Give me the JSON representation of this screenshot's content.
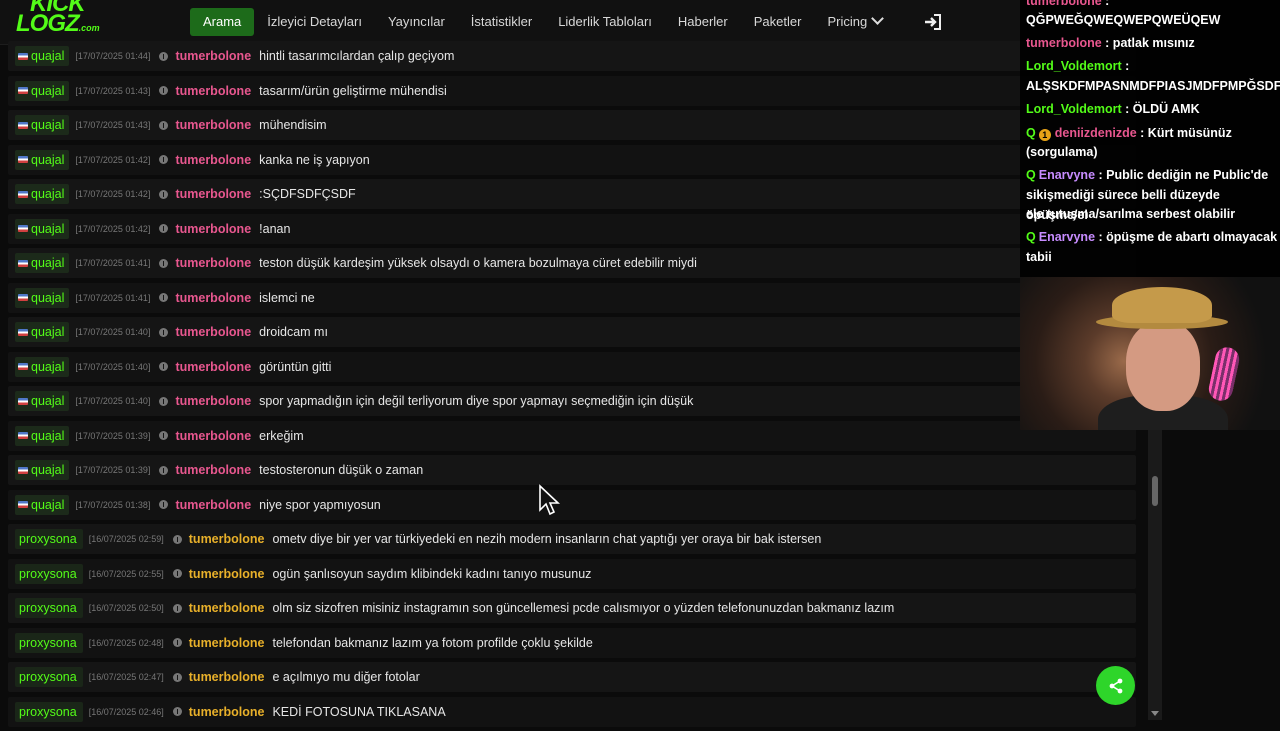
{
  "nav": {
    "logo_top": "KICK",
    "logo_bottom": "LOGZ",
    "logo_suffix": ".com",
    "items": [
      {
        "label": "Arama",
        "active": true
      },
      {
        "label": "İzleyici Detayları"
      },
      {
        "label": "Yayıncılar"
      },
      {
        "label": "İstatistikler"
      },
      {
        "label": "Liderlik Tabloları"
      },
      {
        "label": "Haberler"
      },
      {
        "label": "Paketler"
      },
      {
        "label": "Pricing"
      }
    ]
  },
  "messages": [
    {
      "channel": "quajal",
      "timestamp": "[17/07/2025 01:44]",
      "user": "tumerbolone",
      "text": "hintli tasarımcılardan çalıp geçiyom"
    },
    {
      "channel": "quajal",
      "timestamp": "[17/07/2025 01:43]",
      "user": "tumerbolone",
      "text": "tasarım/ürün geliştirme mühendisi"
    },
    {
      "channel": "quajal",
      "timestamp": "[17/07/2025 01:43]",
      "user": "tumerbolone",
      "text": "mühendisim"
    },
    {
      "channel": "quajal",
      "timestamp": "[17/07/2025 01:42]",
      "user": "tumerbolone",
      "text": "kanka ne iş yapıyon"
    },
    {
      "channel": "quajal",
      "timestamp": "[17/07/2025 01:42]",
      "user": "tumerbolone",
      "text": ":SÇDFSDFÇSDF"
    },
    {
      "channel": "quajal",
      "timestamp": "[17/07/2025 01:42]",
      "user": "tumerbolone",
      "text": "!anan"
    },
    {
      "channel": "quajal",
      "timestamp": "[17/07/2025 01:41]",
      "user": "tumerbolone",
      "text": "teston düşük kardeşim yüksek olsaydı o kamera bozulmaya cüret edebilir miydi"
    },
    {
      "channel": "quajal",
      "timestamp": "[17/07/2025 01:41]",
      "user": "tumerbolone",
      "text": "islemci ne"
    },
    {
      "channel": "quajal",
      "timestamp": "[17/07/2025 01:40]",
      "user": "tumerbolone",
      "text": "droidcam mı"
    },
    {
      "channel": "quajal",
      "timestamp": "[17/07/2025 01:40]",
      "user": "tumerbolone",
      "text": "görüntün gitti"
    },
    {
      "channel": "quajal",
      "timestamp": "[17/07/2025 01:40]",
      "user": "tumerbolone",
      "text": "spor yapmadığın için değil terliyorum diye spor yapmayı seçmediğin için düşük"
    },
    {
      "channel": "quajal",
      "timestamp": "[17/07/2025 01:39]",
      "user": "tumerbolone",
      "text": "erkeğim"
    },
    {
      "channel": "quajal",
      "timestamp": "[17/07/2025 01:39]",
      "user": "tumerbolone",
      "text": "testosteronun düşük o zaman"
    },
    {
      "channel": "quajal",
      "timestamp": "[17/07/2025 01:38]",
      "user": "tumerbolone",
      "text": "niye spor yapmıyosun"
    },
    {
      "channel": "proxysona",
      "timestamp": "[16/07/2025 02:59]",
      "user": "tumerbolone",
      "text": "ometv diye bir yer var türkiyedeki en nezih modern insanların chat yaptığı yer oraya bir bak istersen"
    },
    {
      "channel": "proxysona",
      "timestamp": "[16/07/2025 02:55]",
      "user": "tumerbolone",
      "text": "ogün şanlısoyun saydım klibindeki kadını tanıyo musunuz"
    },
    {
      "channel": "proxysona",
      "timestamp": "[16/07/2025 02:50]",
      "user": "tumerbolone",
      "text": "olm siz sizofren misiniz instagramın son güncellemesi pcde calısmıyor o yüzden telefonunuzdan bakmanız lazım"
    },
    {
      "channel": "proxysona",
      "timestamp": "[16/07/2025 02:48]",
      "user": "tumerbolone",
      "text": "telefondan bakmanız lazım ya fotom profilde çoklu şekilde"
    },
    {
      "channel": "proxysona",
      "timestamp": "[16/07/2025 02:47]",
      "user": "tumerbolone",
      "text": "e açılmıyo mu diğer fotolar"
    },
    {
      "channel": "proxysona",
      "timestamp": "[16/07/2025 02:46]",
      "user": "tumerbolone",
      "text": "KEDİ FOTOSUNA TIKLASANA"
    }
  ],
  "overlay_chat": {
    "l0_user": "tumerbolone",
    "l0_sep": " :",
    "l1_text": "QĞPWEĞQWEQWEPQWEÜQEW",
    "l2_user": "tumerbolone",
    "l2_text": " : patlak mısınız",
    "l3_user": "Lord_Voldemort",
    "l3_sep": " :",
    "l4_text": "ALŞSKDFMPASNMDFPIASJMDFPMPĞSDF",
    "l5_user": "Lord_Voldemort",
    "l5_text": " : ÖLDÜ AMK",
    "l6_user": "deniizdenizde",
    "l6_text": " : Kürt müsünüz",
    "l7_text": "(sorgulama)",
    "l8_user": "Enarvyne",
    "l8_text": " : Public dediğin ne Public'de",
    "l9_text": "sikişmediği sürece belli düzeyde öpüşme/el",
    "l10_text": "ele tutuşma/sarılma serbest olabilir",
    "l11_user": "Enarvyne",
    "l11_text": " : öpüşme de abartı olmayacak",
    "l12_text": "tabii",
    "badge_q": "Q",
    "badge_num": "1"
  }
}
